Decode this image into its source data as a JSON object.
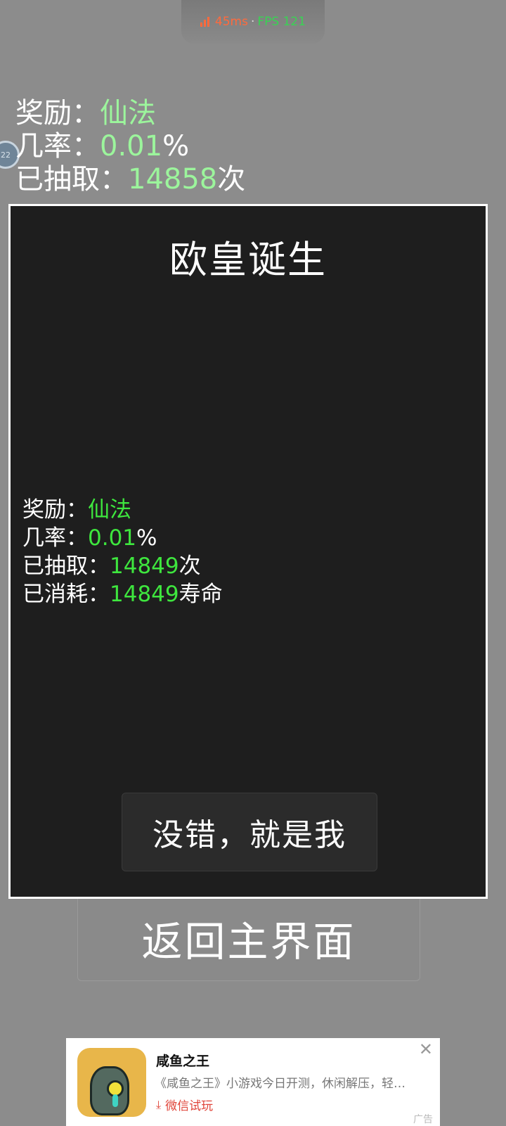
{
  "perf": {
    "ms": "45ms",
    "separator": "·",
    "fps": "FPS 121"
  },
  "background": {
    "side_badge": "22",
    "rows": [
      {
        "label": "奖励：",
        "value": "仙法",
        "suffix": ""
      },
      {
        "label": "几率：",
        "value": "0.01",
        "suffix": "%"
      },
      {
        "label": "已抽取：",
        "value": "14858",
        "suffix": "次"
      }
    ]
  },
  "modal": {
    "title": "欧皇诞生",
    "rows": [
      {
        "label": "奖励：",
        "value": "仙法",
        "suffix": ""
      },
      {
        "label": "几率：",
        "value": "0.01",
        "suffix": "%"
      },
      {
        "label": "已抽取：",
        "value": "14849",
        "suffix": "次"
      },
      {
        "label": "已消耗：",
        "value": "14849",
        "suffix": "寿命"
      }
    ],
    "confirm_label": "没错，就是我"
  },
  "return_label": "返回主界面",
  "ad": {
    "title": "咸鱼之王",
    "description": "《咸鱼之王》小游戏今日开测，休闲解压，轻…",
    "cta": "微信试玩",
    "close": "✕",
    "tag": "广告"
  },
  "colors": {
    "value_green_bg": "#9cf59c",
    "value_green_modal": "#3ee63e",
    "modal_bg": "#1e1e1e",
    "overlay_bg": "#8c8c8c",
    "cta_red": "#e0453a"
  }
}
